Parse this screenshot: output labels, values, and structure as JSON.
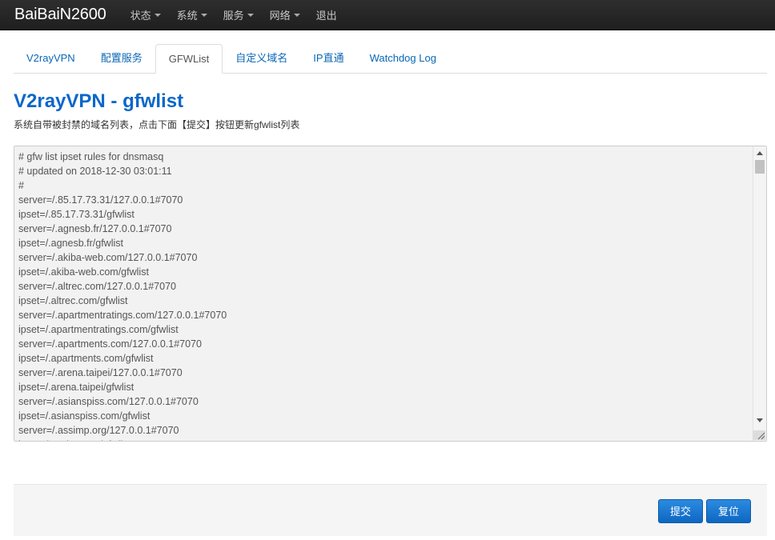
{
  "navbar": {
    "brand": "BaiBaiN2600",
    "menus": [
      {
        "label": "状态",
        "has_dropdown": true
      },
      {
        "label": "系统",
        "has_dropdown": true
      },
      {
        "label": "服务",
        "has_dropdown": true
      },
      {
        "label": "网络",
        "has_dropdown": true
      },
      {
        "label": "退出",
        "has_dropdown": false
      }
    ]
  },
  "tabs": [
    {
      "label": "V2rayVPN",
      "active": false
    },
    {
      "label": "配置服务",
      "active": false
    },
    {
      "label": "GFWList",
      "active": true
    },
    {
      "label": "自定义域名",
      "active": false
    },
    {
      "label": "IP直通",
      "active": false
    },
    {
      "label": "Watchdog Log",
      "active": false
    }
  ],
  "page": {
    "title": "V2rayVPN - gfwlist",
    "description": "系统自带被封禁的域名列表，点击下面【提交】按钮更新gfwlist列表"
  },
  "editor": {
    "lines": [
      "# gfw list ipset rules for dnsmasq",
      "# updated on 2018-12-30 03:01:11",
      "#",
      "server=/.85.17.73.31/127.0.0.1#7070",
      "ipset=/.85.17.73.31/gfwlist",
      "server=/.agnesb.fr/127.0.0.1#7070",
      "ipset=/.agnesb.fr/gfwlist",
      "server=/.akiba-web.com/127.0.0.1#7070",
      "ipset=/.akiba-web.com/gfwlist",
      "server=/.altrec.com/127.0.0.1#7070",
      "ipset=/.altrec.com/gfwlist",
      "server=/.apartmentratings.com/127.0.0.1#7070",
      "ipset=/.apartmentratings.com/gfwlist",
      "server=/.apartments.com/127.0.0.1#7070",
      "ipset=/.apartments.com/gfwlist",
      "server=/.arena.taipei/127.0.0.1#7070",
      "ipset=/.arena.taipei/gfwlist",
      "server=/.asianspiss.com/127.0.0.1#7070",
      "ipset=/.asianspiss.com/gfwlist",
      "server=/.assimp.org/127.0.0.1#7070",
      "ipset=/.assimp.org/gfwlist"
    ]
  },
  "footer": {
    "submit_label": "提交",
    "reset_label": "复位"
  },
  "colors": {
    "navbar_bg": "#222222",
    "link": "#0a67b5",
    "title": "#0a67c9",
    "button": "#0d67c2"
  }
}
